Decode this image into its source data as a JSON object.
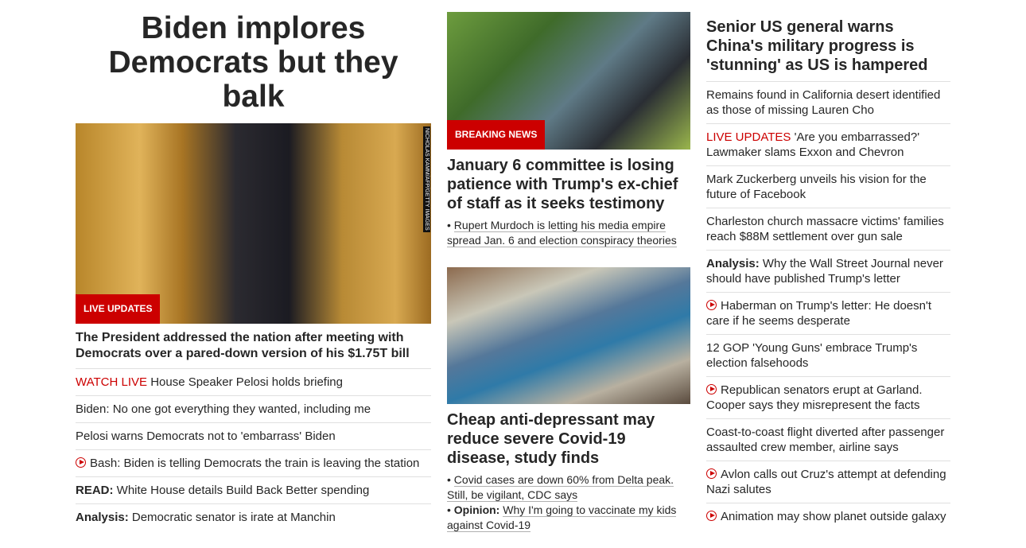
{
  "col1": {
    "headline": "Biden implores Democrats but they balk",
    "image_badge": "LIVE UPDATES",
    "image_credit": "NICHOLAS KAMM/AFP/GETTY IMAGES",
    "subheadline": "The President addressed the nation after meeting with Democrats over a pared-down version of his $1.75T bill",
    "links": [
      {
        "prefix": "WATCH LIVE",
        "text": "House Speaker Pelosi holds briefing"
      },
      {
        "text": "Biden: No one got everything they wanted, including me"
      },
      {
        "text": "Pelosi warns Democrats not to 'embarrass' Biden"
      },
      {
        "icon": "play-icon",
        "text": "Bash: Biden is telling Democrats the train is leaving the station"
      },
      {
        "prefix": "READ:",
        "text": "White House details Build Back Better spending"
      },
      {
        "prefix": "Analysis:",
        "text": "Democratic senator is irate at Manchin"
      }
    ]
  },
  "col2": {
    "story1": {
      "badge": "BREAKING NEWS",
      "headline": "January 6 committee is losing patience with Trump's ex-chief of staff as it seeks testimony",
      "bullets": [
        {
          "text": "Rupert Murdoch is letting his media empire spread Jan. 6 and election conspiracy theories"
        }
      ]
    },
    "story2": {
      "headline": "Cheap anti-depressant may reduce severe Covid-19 disease, study finds",
      "bullets": [
        {
          "text": "Covid cases are down 60% from Delta peak. Still, be vigilant, CDC says"
        },
        {
          "prefix": "Opinion:",
          "text": "Why I'm going to vaccinate my kids against Covid-19"
        }
      ]
    }
  },
  "col3": {
    "headline": "Senior US general warns China's military progress is 'stunning' as US is hampered",
    "links": [
      {
        "text": "Remains found in California desert identified as those of missing Lauren Cho"
      },
      {
        "prefix": "LIVE UPDATES",
        "text": "'Are you embarrassed?' Lawmaker slams Exxon and Chevron"
      },
      {
        "text": "Mark Zuckerberg unveils his vision for the future of Facebook"
      },
      {
        "text": "Charleston church massacre victims' families reach $88M settlement over gun sale"
      },
      {
        "prefix": "Analysis:",
        "text": "Why the Wall Street Journal never should have published Trump's letter"
      },
      {
        "icon": "play-icon",
        "text": "Haberman on Trump's letter: He doesn't care if he seems desperate"
      },
      {
        "text": "12 GOP 'Young Guns' embrace Trump's election falsehoods"
      },
      {
        "icon": "play-icon",
        "text": "Republican senators erupt at Garland. Cooper says they misrepresent the facts"
      },
      {
        "text": "Coast-to-coast flight diverted after passenger assaulted crew member, airline says"
      },
      {
        "icon": "play-icon",
        "text": "Avlon calls out Cruz's attempt at defending Nazi salutes"
      },
      {
        "icon": "play-icon",
        "text": "Animation may show planet outside galaxy"
      }
    ]
  },
  "colors": {
    "accent_red": "#cc0000",
    "text": "#262626",
    "divider": "#e0e0e0"
  }
}
